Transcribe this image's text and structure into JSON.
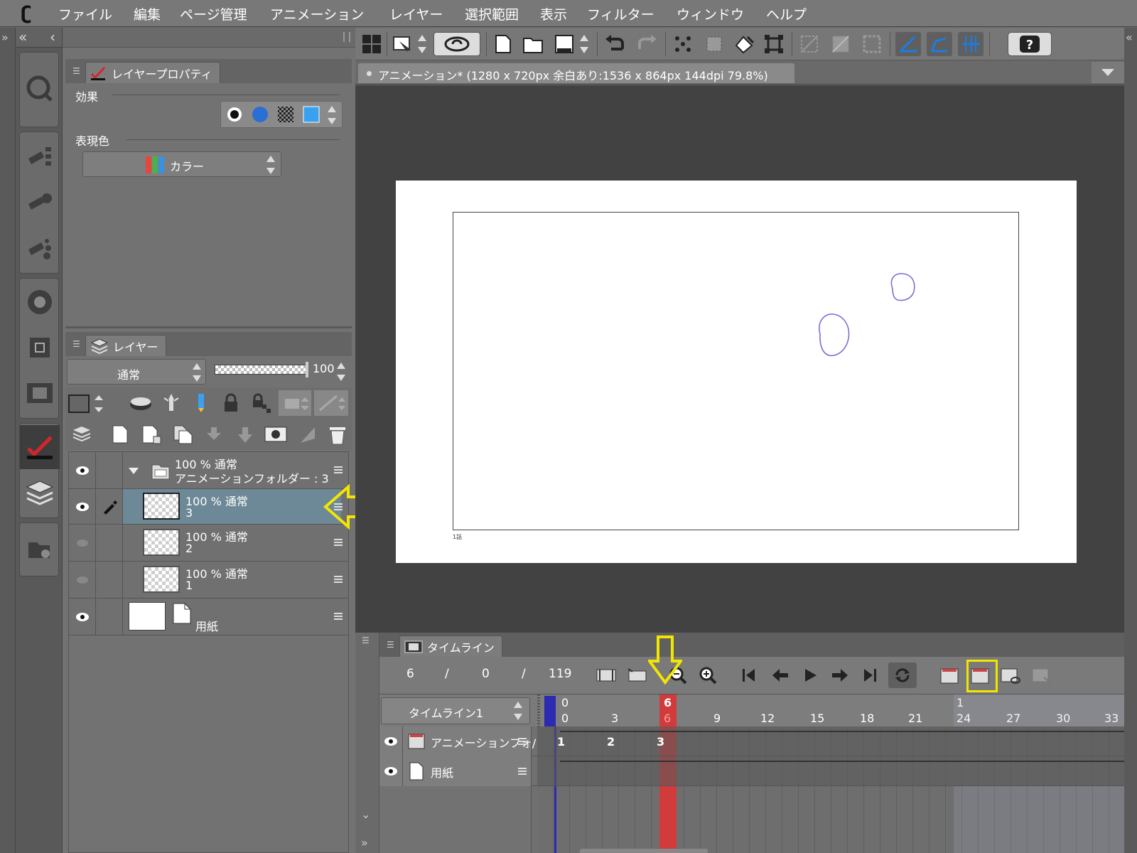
{
  "menubar": {
    "logo_icon": "clip-studio-logo-icon",
    "items": [
      "ファイル",
      "編集",
      "ページ管理",
      "アニメーション",
      "レイヤー",
      "選択範囲",
      "表示",
      "フィルター",
      "ウィンドウ",
      "ヘルプ"
    ]
  },
  "layer_property": {
    "tab_label": "レイヤープロパティ",
    "effect_label": "効果",
    "expression_label": "表現色",
    "expression_value": "カラー"
  },
  "layer_panel": {
    "tab_label": "レイヤー",
    "blend_mode": "通常",
    "opacity": "100",
    "layers": [
      {
        "line1": "100 % 通常",
        "line2": "アニメーションフォルダー : 3",
        "type": "folder",
        "visible": true
      },
      {
        "line1": "100 % 通常",
        "line2": "3",
        "type": "raster",
        "visible": true,
        "selected": true
      },
      {
        "line1": "100 % 通常",
        "line2": "2",
        "type": "raster",
        "visible": false
      },
      {
        "line1": "100 % 通常",
        "line2": "1",
        "type": "raster",
        "visible": false
      },
      {
        "line1": "",
        "line2": "用紙",
        "type": "paper",
        "visible": true
      }
    ]
  },
  "document": {
    "tab_title": "アニメーション* (1280 x 720px 余白あり:1536 x 864px 144dpi 79.8%)",
    "paper_label": "1話",
    "stroke_color": "#7b6fd1"
  },
  "timeline": {
    "tab_label": "タイムライン",
    "current_frame": "6",
    "sep1": "/",
    "start_frame": "0",
    "sep2": "/",
    "end_frame": "119",
    "timeline_name": "タイムライン1",
    "ruler_ticks": [
      "0",
      "3",
      "6",
      "9",
      "12",
      "15",
      "18",
      "21",
      "24",
      "27",
      "30",
      "33"
    ],
    "ruler_top": {
      "left": "0",
      "current": "6",
      "page": "1"
    },
    "tracks": [
      {
        "name": "アニメーションフォ/",
        "icon": "animation-folder-icon",
        "cels": [
          "1",
          "2",
          "3"
        ]
      },
      {
        "name": "用紙",
        "icon": "paper-icon",
        "cels": []
      }
    ]
  },
  "colors": {
    "playhead": "#d13b3b",
    "highlight": "#f2e600",
    "selected_row": "#6d8896"
  }
}
